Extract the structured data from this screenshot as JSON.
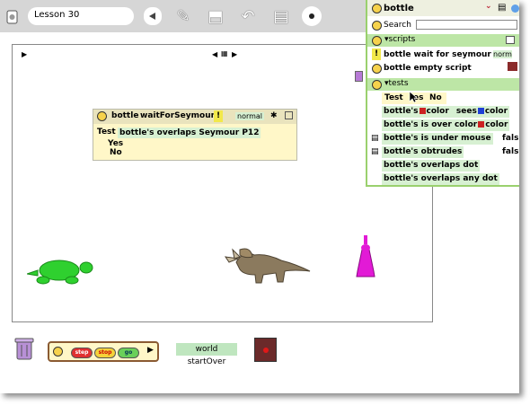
{
  "toolbar": {
    "project_name": "Lesson 30",
    "icons": [
      "triangle-left-icon",
      "paint-brush-icon",
      "supplies-icon",
      "undo-icon",
      "navigator-icon",
      "dot-icon"
    ]
  },
  "world": {
    "script": {
      "player": "bottle",
      "name": "waitForSeymour",
      "warning": "!",
      "status": "normal",
      "test_label": "Test",
      "test_condition": "bottle's overlaps Seymour P12",
      "yes_label": "Yes",
      "no_label": "No"
    }
  },
  "control_panel": {
    "step": "step",
    "stop": "stop",
    "go": "go"
  },
  "startover_label": "world startOver",
  "viewer": {
    "title": "bottle",
    "search_label": "Search",
    "scripts_section": "scripts",
    "scripts": [
      {
        "warning": "!",
        "label": "bottle wait for seymour",
        "status": "norm"
      },
      {
        "label": "bottle empty script"
      }
    ],
    "tests_section": "tests",
    "test_tile": {
      "test": "Test",
      "yes": "es",
      "no": "No"
    },
    "tests": [
      {
        "pre": "bottle's",
        "mid": "color",
        "post": "sees",
        "end": "color"
      },
      {
        "pre": "bottle's is over color",
        "end": "color"
      },
      {
        "label": "bottle's is under mouse",
        "value": "fals"
      },
      {
        "label": "bottle's obtrudes",
        "value": "fals"
      },
      {
        "label": "bottle's overlaps dot"
      },
      {
        "label": "bottle's overlaps any dot"
      }
    ]
  },
  "colors": {
    "toolbar": "#d6d6d6",
    "viewer_border": "#9ad06e",
    "section": "#bde6a6",
    "swatch_red": "#cc2222",
    "swatch_blue": "#1f3fd6"
  }
}
